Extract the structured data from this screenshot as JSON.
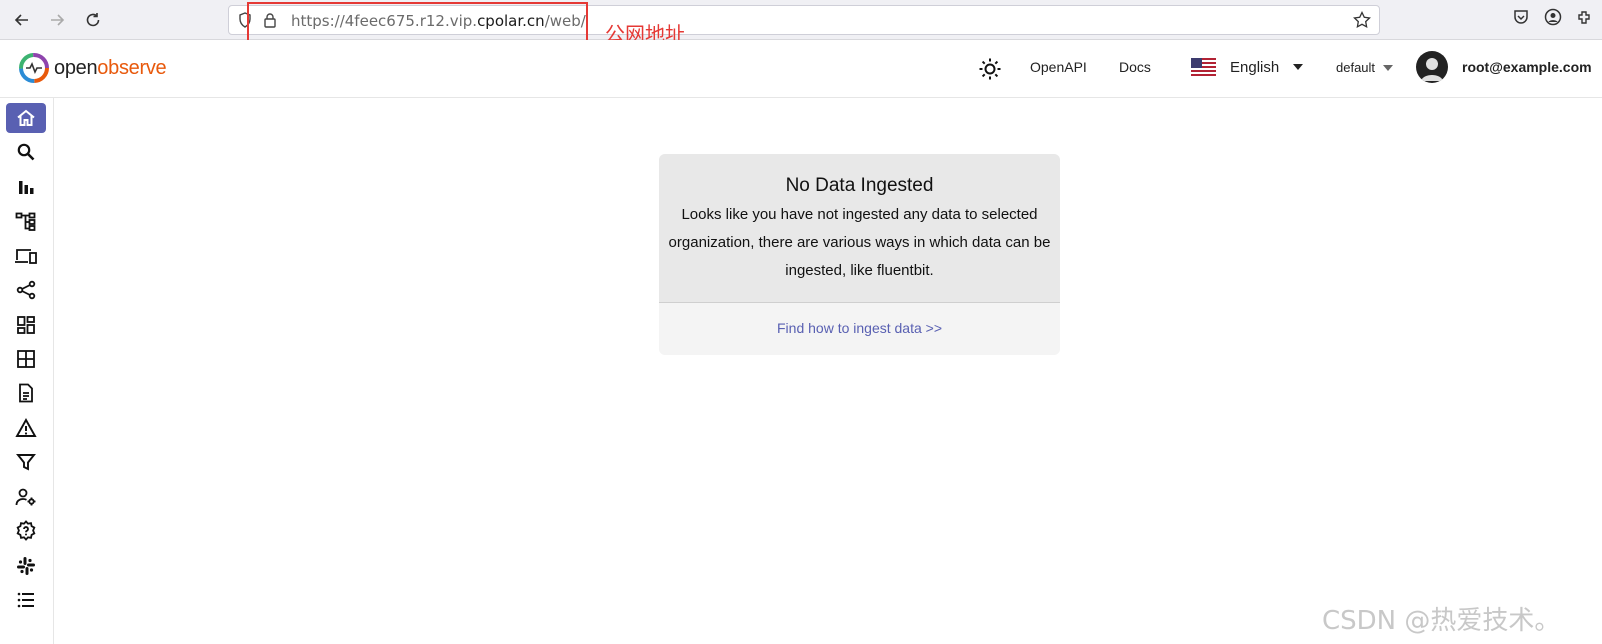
{
  "browser": {
    "url_prefix": "https://4feec675.r12.vip.",
    "url_domain": "cpolar.cn",
    "url_suffix": "/web/",
    "annotation": "公网地址"
  },
  "header": {
    "logo_part1": "open",
    "logo_part2": "observe",
    "openapi_label": "OpenAPI",
    "docs_label": "Docs",
    "language": "English",
    "organization": "default",
    "user_email": "root@example.com"
  },
  "sidebar": {
    "items": [
      {
        "icon": "home-icon"
      },
      {
        "icon": "search-icon"
      },
      {
        "icon": "bar-chart-icon"
      },
      {
        "icon": "hierarchy-icon"
      },
      {
        "icon": "devices-icon"
      },
      {
        "icon": "share-nodes-icon"
      },
      {
        "icon": "dashboard-icon"
      },
      {
        "icon": "table-grid-icon"
      },
      {
        "icon": "document-icon"
      },
      {
        "icon": "alert-warning-icon"
      },
      {
        "icon": "filter-icon"
      },
      {
        "icon": "user-settings-icon"
      },
      {
        "icon": "gear-help-icon"
      },
      {
        "icon": "slack-icon"
      },
      {
        "icon": "list-icon"
      }
    ]
  },
  "main": {
    "card_title": "No Data Ingested",
    "card_body": "Looks like you have not ingested any data to selected organization, there are various ways in which data can be ingested, like fluentbit.",
    "card_link": "Find how to ingest data >>"
  },
  "watermark": "CSDN @热爱技术。",
  "colors": {
    "accent": "#5960b2",
    "logo_orange": "#e8590c",
    "annotation_red": "#e53935"
  }
}
